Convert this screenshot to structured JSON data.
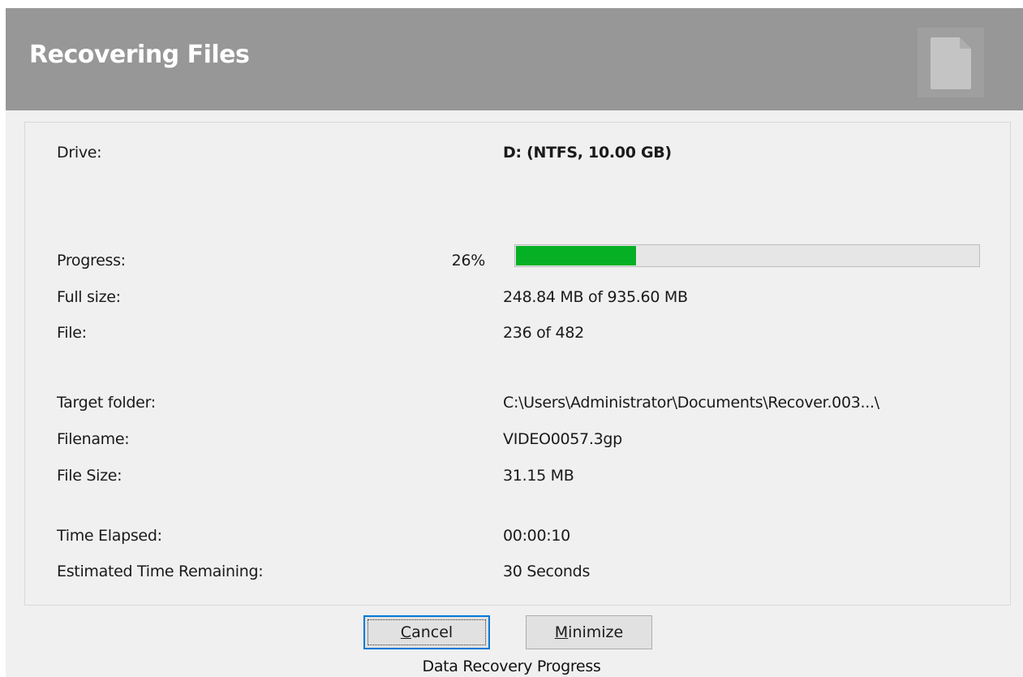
{
  "header": {
    "title": "Recovering Files",
    "icon": "document-icon"
  },
  "details": {
    "drive": {
      "label": "Drive:",
      "value": "D: (NTFS, 10.00 GB)"
    },
    "progress": {
      "label": "Progress:",
      "percent_text": "26%",
      "fraction": 0.26
    },
    "full_size": {
      "label": "Full size:",
      "value": "248.84 MB of 935.60 MB"
    },
    "file": {
      "label": "File:",
      "value": "236 of 482"
    },
    "target_folder": {
      "label": "Target folder:",
      "value": "C:\\Users\\Administrator\\Documents\\Recover.003...\\"
    },
    "filename": {
      "label": "Filename:",
      "value": "VIDEO0057.3gp"
    },
    "file_size": {
      "label": "File Size:",
      "value": "31.15 MB"
    },
    "time_elapsed": {
      "label": "Time Elapsed:",
      "value": "00:00:10"
    },
    "time_remaining": {
      "label": "Estimated Time Remaining:",
      "value": "30 Seconds"
    }
  },
  "buttons": {
    "cancel": {
      "mnemonic": "C",
      "rest": "ancel"
    },
    "minimize": {
      "mnemonic": "M",
      "rest": "inimize"
    }
  },
  "caption": "Data Recovery Progress",
  "colors": {
    "header_bg": "#979797",
    "progress_fill": "#06b025",
    "default_button_border": "#0078d7"
  }
}
